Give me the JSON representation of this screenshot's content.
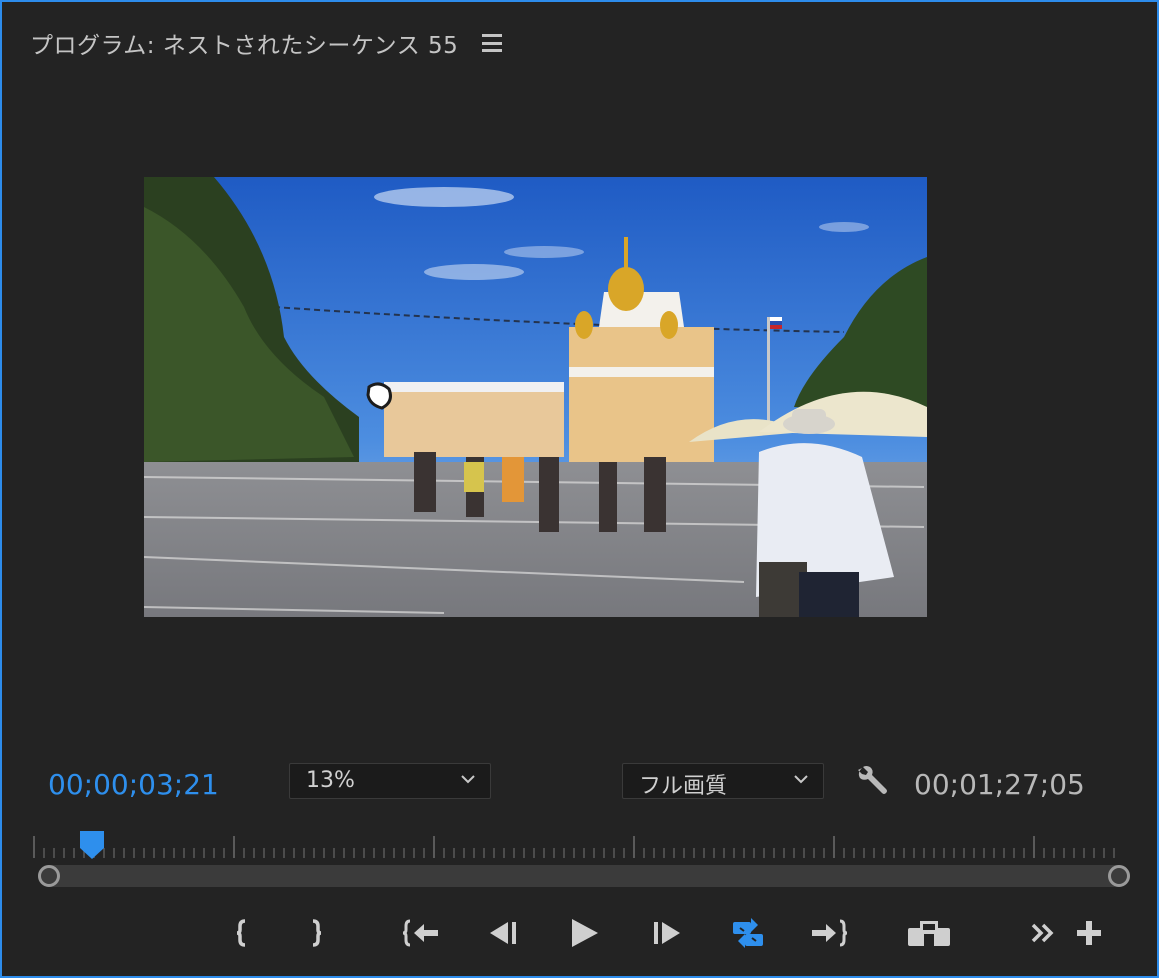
{
  "panel": {
    "title": "プログラム: ネストされたシーケンス 55",
    "menu_icon": "hamburger-menu-icon"
  },
  "viewer": {
    "content": "video-frame"
  },
  "timecode": {
    "current": "00;00;03;21",
    "duration": "00;01;27;05"
  },
  "zoom": {
    "value": "13%",
    "icon": "chevron-down-icon"
  },
  "quality": {
    "value": "フル画質",
    "icon": "chevron-down-icon"
  },
  "settings_icon": "wrench-icon",
  "transport": {
    "buttons": [
      {
        "name": "mark-in-button",
        "icon": "mark-in-icon"
      },
      {
        "name": "mark-out-button",
        "icon": "mark-out-icon"
      },
      {
        "name": "go-to-in-button",
        "icon": "go-to-in-icon"
      },
      {
        "name": "step-back-button",
        "icon": "step-back-icon"
      },
      {
        "name": "play-button",
        "icon": "play-icon"
      },
      {
        "name": "step-forward-button",
        "icon": "step-forward-icon"
      },
      {
        "name": "loop-button",
        "icon": "loop-icon",
        "active": true
      },
      {
        "name": "go-to-out-button",
        "icon": "go-to-out-icon"
      },
      {
        "name": "export-frame-button",
        "icon": "camera-icon"
      },
      {
        "name": "more-controls-button",
        "icon": "double-chevron-icon"
      },
      {
        "name": "button-editor-button",
        "icon": "plus-icon"
      }
    ]
  },
  "colors": {
    "accent": "#2e8fed",
    "background": "#232323",
    "text": "#c4c4c4"
  },
  "playhead_position_fraction": 0.04
}
